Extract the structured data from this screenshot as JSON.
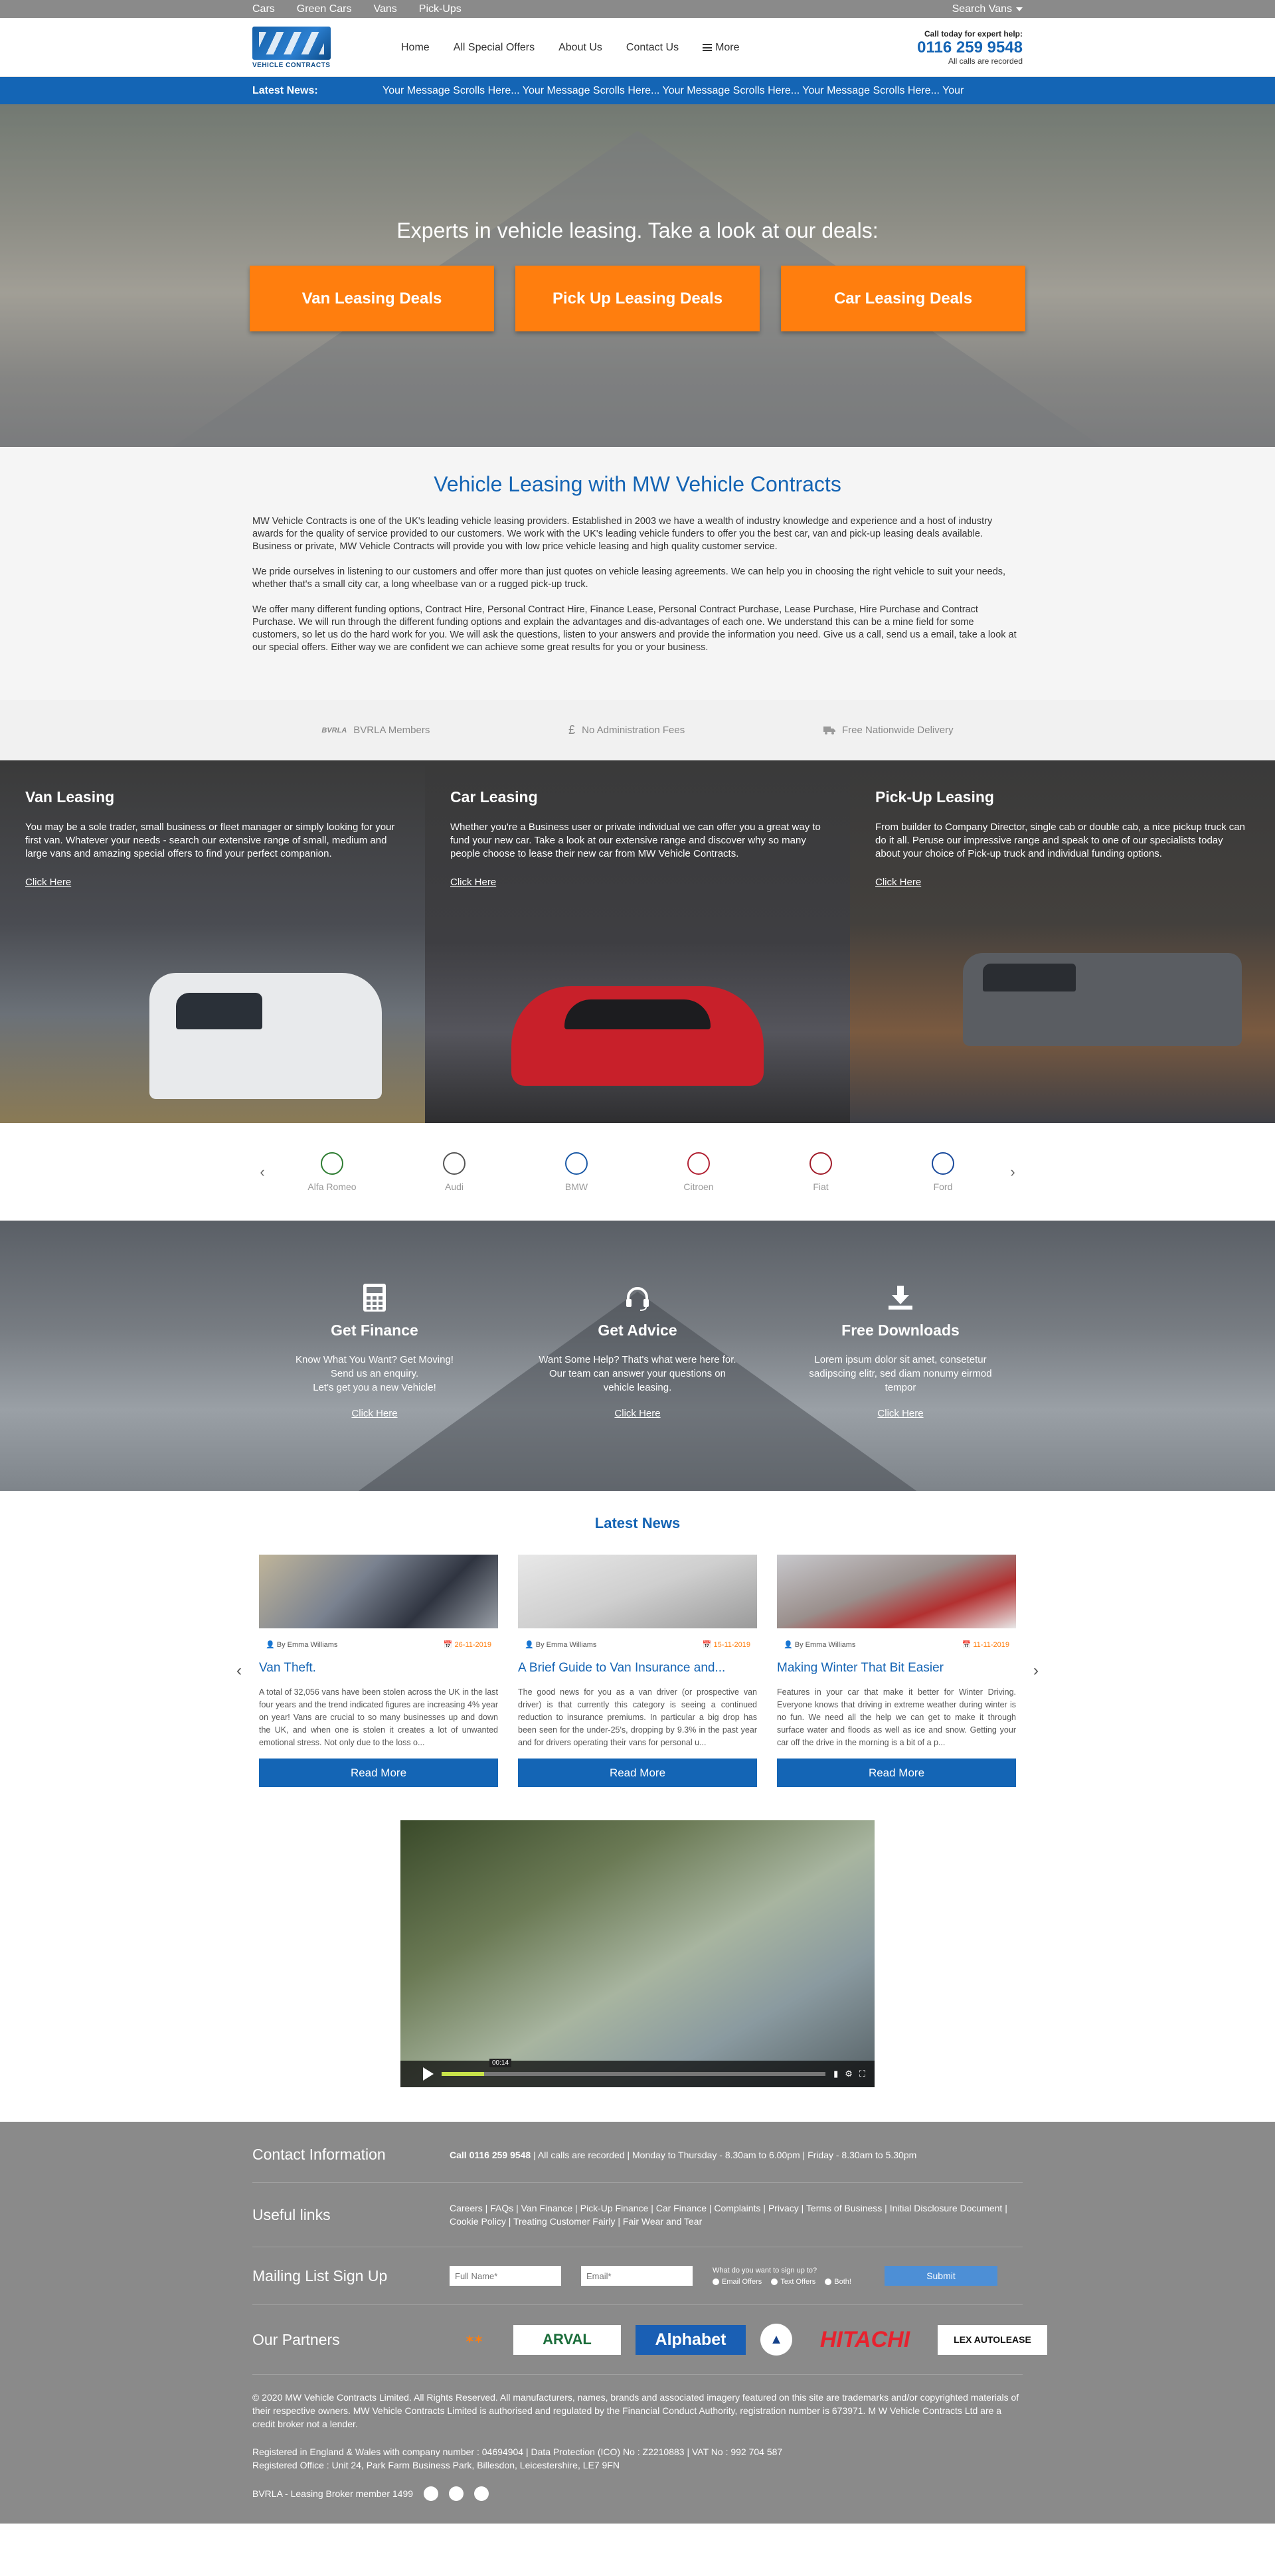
{
  "topbar": {
    "links": [
      "Cars",
      "Green Cars",
      "Vans",
      "Pick-Ups"
    ],
    "search_label": "Search Vans"
  },
  "header": {
    "logo_text": "VEHICLE CONTRACTS",
    "nav": [
      "Home",
      "All Special Offers",
      "About Us",
      "Contact Us"
    ],
    "more_label": "More",
    "call_label": "Call today for expert help:",
    "phone": "0116 259 9548",
    "recorded": "All calls are recorded"
  },
  "newsbar": {
    "label": "Latest News:",
    "message": "Your Message Scrolls Here... Your Message Scrolls Here... Your Message Scrolls Here... Your Message Scrolls Here... Your"
  },
  "hero": {
    "heading": "Experts in vehicle leasing. Take a look at our deals:",
    "buttons": [
      "Van Leasing Deals",
      "Pick Up Leasing Deals",
      "Car Leasing Deals"
    ]
  },
  "intro": {
    "title": "Vehicle Leasing with MW Vehicle Contracts",
    "paragraphs": [
      "MW Vehicle Contracts is one of the UK's leading vehicle leasing providers. Established in 2003 we have a wealth of industry knowledge and experience and a host of industry awards for the quality of service provided to our customers. We work with the UK's leading vehicle funders to offer you the best car, van and pick-up leasing deals available. Business or private, MW Vehicle Contracts will provide you with low price vehicle leasing and high quality customer service.",
      "We pride ourselves in listening to our customers and offer more than just quotes on vehicle leasing agreements. We can help you in choosing the right vehicle to suit your needs, whether that's a small city car, a long wheelbase van or a rugged pick-up truck.",
      "We offer many different funding options, Contract Hire, Personal Contract Hire, Finance Lease, Personal Contract Purchase, Lease Purchase, Hire Purchase and Contract Purchase. We will run through the different funding options and explain the advantages and dis-advantages of each one. We understand this can be a mine field for some customers, so let us do the hard work for you. We will ask the questions, listen to your answers and provide the information you need. Give us a call, send us a email, take a look at our special offers. Either way we are confident we can achieve some great results for you or your business."
    ]
  },
  "features": [
    {
      "icon": "bvrla-icon",
      "icon_text": "BVRLA",
      "label": "BVRLA Members"
    },
    {
      "icon": "pound-icon",
      "icon_text": "£",
      "label": "No Administration Fees"
    },
    {
      "icon": "truck-icon",
      "icon_text": "",
      "label": "Free Nationwide Delivery"
    }
  ],
  "panels": [
    {
      "title": "Van Leasing",
      "text": "You may be a sole trader, small business or fleet manager or simply looking for your first van. Whatever your needs - search our extensive range of small, medium and large vans and amazing special offers to find your perfect companion.",
      "link": "Click Here"
    },
    {
      "title": "Car Leasing",
      "text": "Whether you're a Business user or private individual we can offer you a great way to fund your new car. Take a look at our extensive range and discover why so many people choose to lease their new car from MW Vehicle Contracts.",
      "link": "Click Here"
    },
    {
      "title": "Pick-Up Leasing",
      "text": "From builder to Company Director, single cab or double cab, a nice pickup truck can do it all. Peruse our impressive range and speak to one of our specialists today about your choice of Pick-up truck and individual funding options.",
      "link": "Click Here"
    }
  ],
  "brands": [
    {
      "name": "Alfa Romeo",
      "color": "#2e7d32"
    },
    {
      "name": "Audi",
      "color": "#555555"
    },
    {
      "name": "BMW",
      "color": "#1c5aa6"
    },
    {
      "name": "Citroen",
      "color": "#b22234"
    },
    {
      "name": "Fiat",
      "color": "#a11c2a"
    },
    {
      "name": "Ford",
      "color": "#1a4a9c"
    }
  ],
  "services": [
    {
      "icon": "calculator-icon",
      "title": "Get Finance",
      "lines": [
        "Know What You Want? Get Moving!",
        "Send us an enquiry.",
        "Let's get you a new Vehicle!"
      ],
      "link": "Click Here"
    },
    {
      "icon": "headset-icon",
      "title": "Get Advice",
      "lines": [
        "Want Some Help? That's what were here for. Our team can answer your questions on vehicle leasing."
      ],
      "link": "Click Here"
    },
    {
      "icon": "download-icon",
      "title": "Free Downloads",
      "lines": [
        "Lorem ipsum dolor sit amet, consetetur sadipscing elitr, sed diam nonumy eirmod tempor"
      ],
      "link": "Click Here"
    }
  ],
  "latest_news": {
    "title": "Latest News",
    "button_label": "Read More",
    "items": [
      {
        "author": "By Emma Williams",
        "date": "26-11-2019",
        "title": "Van Theft.",
        "excerpt": "A total of 32,056 vans have been stolen across the UK in the last four years and the trend indicated figures are increasing 4% year on year! Vans are crucial to so many businesses up and down the UK, and when one is stolen it creates a lot of unwanted emotional stress. Not only due to the loss o..."
      },
      {
        "author": "By Emma Williams",
        "date": "15-11-2019",
        "title": "A Brief Guide to Van Insurance and...",
        "excerpt": "The good news for you as a van driver (or prospective van driver) is that currently this category is seeing a continued reduction to insurance premiums. In particular a big drop has been seen for the under-25's, dropping by 9.3% in the past year and for drivers operating their vans for personal u..."
      },
      {
        "author": "By Emma Williams",
        "date": "11-11-2019",
        "title": "Making Winter That Bit Easier",
        "excerpt": "Features in your car that make it better for Winter Driving. Everyone knows that driving in extreme weather during winter is no fun. We need all the help we can get to make it through surface water and floods as well as ice and snow. Getting your car off the drive in the morning is a bit of a p..."
      }
    ]
  },
  "video": {
    "time": "00:14",
    "progress": 0.11
  },
  "footer": {
    "contact_title": "Contact Information",
    "contact_phone": "Call 0116 259 9548",
    "contact_rest": " | All calls are recorded | Monday to Thursday - 8.30am to 6.00pm | Friday - 8.30am to 5.30pm",
    "links_title": "Useful links",
    "links_text": "Careers | FAQs | Van Finance | Pick-Up Finance | Car Finance | Complaints | Privacy | Terms of Business | Initial Disclosure Document | Cookie Policy | Treating Customer Fairly | Fair Wear and Tear",
    "mailing_title": "Mailing List Sign Up",
    "name_placeholder": "Full Name*",
    "email_placeholder": "Email*",
    "signup_question": "What do you want to sign up to?",
    "signup_options": [
      "Email Offers",
      "Text Offers",
      "Both!"
    ],
    "submit_label": "Submit",
    "partners_title": "Our Partners",
    "partners": [
      "",
      "ARVAL",
      "Alphabet",
      "",
      "HITACHI",
      "LEX AUTOLEASE"
    ],
    "legal_1": "© 2020 MW Vehicle Contracts Limited. All Rights Reserved. All manufacturers, names, brands and associated imagery featured on this site are trademarks and/or copyrighted materials of their respective owners. MW Vehicle Contracts Limited is authorised and regulated by the Financial Conduct Authority, registration number is 673971. M W Vehicle Contracts Ltd are a credit broker not a lender.",
    "legal_2a": "Registered in England & Wales with company number : 04694904 | Data Protection (ICO) No : Z2210883 | VAT No : 992 704 587",
    "legal_2b": "Registered Office : Unit 24, Park Farm Business Park, Billesdon, Leicestershire, LE7 9FN",
    "bvrla": "BVRLA - Leasing Broker member 1499"
  }
}
